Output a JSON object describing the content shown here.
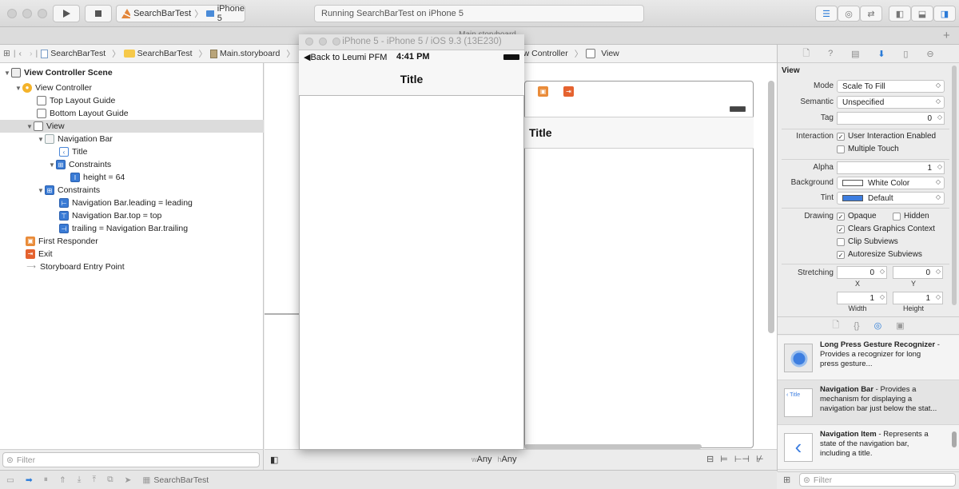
{
  "toolbar": {
    "scheme_target": "SearchBarTest",
    "scheme_device": "iPhone 5",
    "activity": "Running SearchBarTest on iPhone 5"
  },
  "tab": {
    "title": "Main.storyboard"
  },
  "jumpbar": {
    "crumbs": [
      "SearchBarTest",
      "SearchBarTest",
      "Main.storyboard"
    ],
    "tail_prefix": "ew Controller",
    "tail": "View"
  },
  "outline": {
    "items": [
      {
        "label": "View Controller Scene"
      },
      {
        "label": "View Controller"
      },
      {
        "label": "Top Layout Guide"
      },
      {
        "label": "Bottom Layout Guide"
      },
      {
        "label": "View"
      },
      {
        "label": "Navigation Bar"
      },
      {
        "label": "Title"
      },
      {
        "label": "Constraints"
      },
      {
        "label": "height = 64"
      },
      {
        "label": "Constraints"
      },
      {
        "label": "Navigation Bar.leading = leading"
      },
      {
        "label": "Navigation Bar.top = top"
      },
      {
        "label": "trailing = Navigation Bar.trailing"
      },
      {
        "label": "First Responder"
      },
      {
        "label": "Exit"
      },
      {
        "label": "Storyboard Entry Point"
      }
    ],
    "filter_placeholder": "Filter"
  },
  "canvas": {
    "scene_title": "Title",
    "size_w_label": "w",
    "size_w": "Any",
    "size_h_label": "h",
    "size_h": "Any"
  },
  "simulator": {
    "window_title": "iPhone 5 - iPhone 5 / iOS 9.3 (13E230)",
    "back_label": "Back to Leumi PFM",
    "time": "4:41 PM",
    "nav_title": "Title"
  },
  "inspector": {
    "section": "View",
    "mode_label": "Mode",
    "mode_value": "Scale To Fill",
    "semantic_label": "Semantic",
    "semantic_value": "Unspecified",
    "tag_label": "Tag",
    "tag_value": "0",
    "interaction_label": "Interaction",
    "user_interaction": "User Interaction Enabled",
    "multiple_touch": "Multiple Touch",
    "alpha_label": "Alpha",
    "alpha_value": "1",
    "background_label": "Background",
    "background_value": "White Color",
    "tint_label": "Tint",
    "tint_value": "Default",
    "drawing_label": "Drawing",
    "opaque": "Opaque",
    "hidden": "Hidden",
    "clears": "Clears Graphics Context",
    "clip": "Clip Subviews",
    "autoresize": "Autoresize Subviews",
    "stretching_label": "Stretching",
    "stretch_x": "0",
    "stretch_y": "0",
    "stretch_w": "1",
    "stretch_h": "1",
    "x_label": "X",
    "y_label": "Y",
    "width_label": "Width",
    "height_label": "Height",
    "tint_color": "#3d7ee0"
  },
  "library": {
    "items": [
      {
        "title": "Long Press Gesture Recognizer",
        "desc": " - Provides a recognizer for long press gesture..."
      },
      {
        "title": "Navigation Bar",
        "desc": " - Provides a mechanism for displaying a navigation bar just below the stat..."
      },
      {
        "title": "Navigation Item",
        "desc": " - Represents a state of the navigation bar, including a title."
      }
    ],
    "filter_placeholder": "Filter",
    "nav_icon_text": "Title"
  },
  "debugbar": {
    "target": "SearchBarTest"
  }
}
